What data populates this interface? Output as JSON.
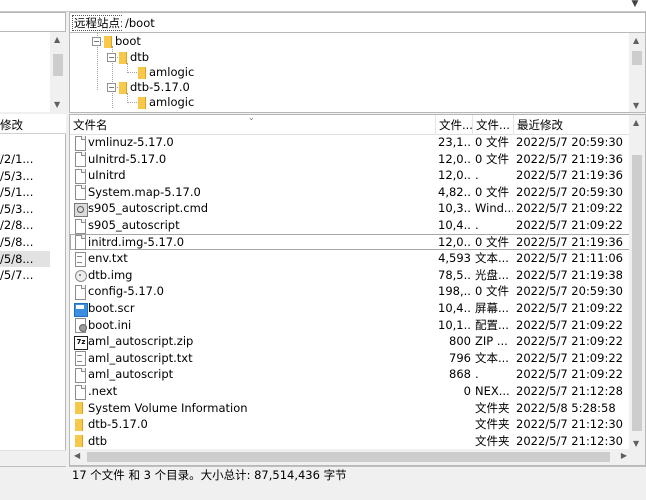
{
  "local": {
    "header": "修改",
    "rows": [
      "/2/1...",
      "/5/3...",
      "/5/1...",
      "/5/3...",
      "/2/8...",
      "/5/8...",
      "/5/8...",
      "/5/7..."
    ],
    "selected_index": 6
  },
  "remote": {
    "label": "远程站点:",
    "path": "/boot",
    "tree": [
      {
        "name": "boot",
        "toggle": "−"
      },
      {
        "name": "dtb",
        "toggle": "−"
      },
      {
        "name": "amlogic",
        "toggle": ""
      },
      {
        "name": "dtb-5.17.0",
        "toggle": "−"
      },
      {
        "name": "amlogic",
        "toggle": ""
      }
    ],
    "columns": {
      "name": "文件名",
      "size": "文件...",
      "type": "文件...",
      "modified": "最近修改"
    },
    "files": [
      {
        "icon": "file-icon",
        "name": "vmlinuz-5.17.0",
        "size": "23,1...",
        "type": "0 文件",
        "modified": "2022/5/7 20:59:30"
      },
      {
        "icon": "file-icon",
        "name": "uInitrd-5.17.0",
        "size": "12,0...",
        "type": "0 文件",
        "modified": "2022/5/7 21:19:36"
      },
      {
        "icon": "file-icon",
        "name": "uInitrd",
        "size": "12,0...",
        "type": ".",
        "modified": "2022/5/7 21:19:36"
      },
      {
        "icon": "file-icon",
        "name": "System.map-5.17.0",
        "size": "4,82...",
        "type": "0 文件",
        "modified": "2022/5/7 20:59:30"
      },
      {
        "icon": "cmd-icon",
        "name": "s905_autoscript.cmd",
        "size": "10,3...",
        "type": "Wind...",
        "modified": "2022/5/7 21:09:22"
      },
      {
        "icon": "file-icon",
        "name": "s905_autoscript",
        "size": "10,4...",
        "type": ".",
        "modified": "2022/5/7 21:09:22"
      },
      {
        "icon": "file-icon",
        "name": "initrd.img-5.17.0",
        "size": "12,0...",
        "type": "0 文件",
        "modified": "2022/5/7 21:19:36"
      },
      {
        "icon": "text-file-icon",
        "name": "env.txt",
        "size": "4,593",
        "type": "文本...",
        "modified": "2022/5/7 21:11:06"
      },
      {
        "icon": "disc-image-icon",
        "name": "dtb.img",
        "size": "78,5...",
        "type": "光盘...",
        "modified": "2022/5/7 21:19:38"
      },
      {
        "icon": "file-icon",
        "name": "config-5.17.0",
        "size": "198,...",
        "type": "0 文件",
        "modified": "2022/5/7 20:59:30"
      },
      {
        "icon": "screensaver-icon",
        "name": "boot.scr",
        "size": "10,4...",
        "type": "屏幕...",
        "modified": "2022/5/7 21:09:22"
      },
      {
        "icon": "config-file-icon",
        "name": "boot.ini",
        "size": "10,1...",
        "type": "配置...",
        "modified": "2022/5/7 21:09:22"
      },
      {
        "icon": "zip-archive-icon",
        "name": "aml_autoscript.zip",
        "size": "800",
        "type": "ZIP ...",
        "modified": "2022/5/7 21:09:22"
      },
      {
        "icon": "text-file-icon",
        "name": "aml_autoscript.txt",
        "size": "796",
        "type": "文本...",
        "modified": "2022/5/7 21:09:22"
      },
      {
        "icon": "file-icon",
        "name": "aml_autoscript",
        "size": "868",
        "type": ".",
        "modified": "2022/5/7 21:09:22"
      },
      {
        "icon": "file-icon",
        "name": ".next",
        "size": "0",
        "type": "NEX...",
        "modified": "2022/5/7 21:12:28"
      },
      {
        "icon": "folder-icon",
        "name": "System Volume Information",
        "size": "",
        "type": "文件夹",
        "modified": "2022/5/8 5:28:58"
      },
      {
        "icon": "folder-icon",
        "name": "dtb-5.17.0",
        "size": "",
        "type": "文件夹",
        "modified": "2022/5/7 21:12:30"
      },
      {
        "icon": "folder-icon",
        "name": "dtb",
        "size": "",
        "type": "文件夹",
        "modified": "2022/5/7 21:12:30"
      }
    ],
    "selected_index": 6,
    "status": "17 个文件 和 3 个目录。大小总计: 87,514,436 字节"
  }
}
